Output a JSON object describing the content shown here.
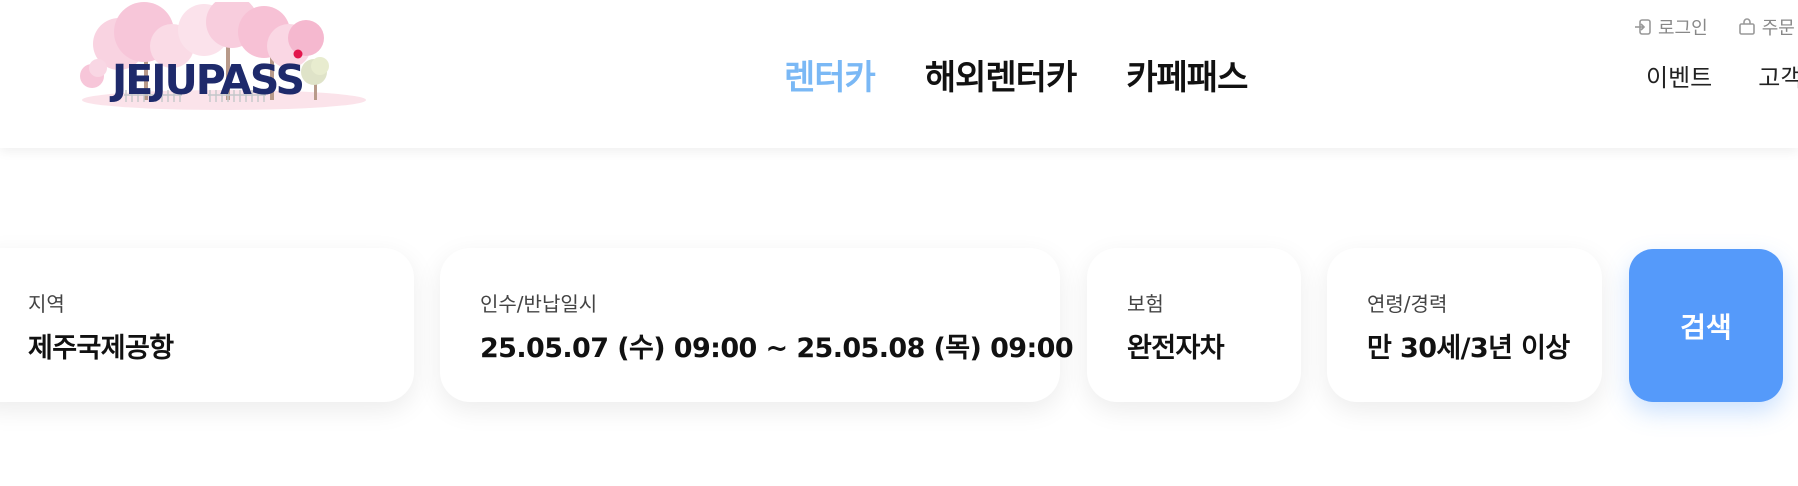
{
  "logo": {
    "text": "JEJUPASS"
  },
  "nav": {
    "items": [
      {
        "label": "렌터카"
      },
      {
        "label": "해외렌터카"
      },
      {
        "label": "카페패스"
      }
    ]
  },
  "util": {
    "login_label": "로그인",
    "order_label": "주문"
  },
  "subnav": {
    "event_label": "이벤트",
    "support_label": "고객"
  },
  "search": {
    "region": {
      "label": "지역",
      "value": "제주국제공항"
    },
    "datetime": {
      "label": "인수/반납일시",
      "value": "25.05.07 (수) 09:00 ~ 25.05.08 (목) 09:00"
    },
    "insurance": {
      "label": "보험",
      "value": "완전자차"
    },
    "age": {
      "label": "연령/경력",
      "value": "만 30세/3년 이상"
    },
    "button_label": "검색"
  },
  "colors": {
    "nav_active": "#7ab8f5",
    "search_button": "#559afa",
    "logo_text": "#1e2a6b",
    "logo_dot": "#e2174d",
    "blossom": "#f7c6d9"
  }
}
